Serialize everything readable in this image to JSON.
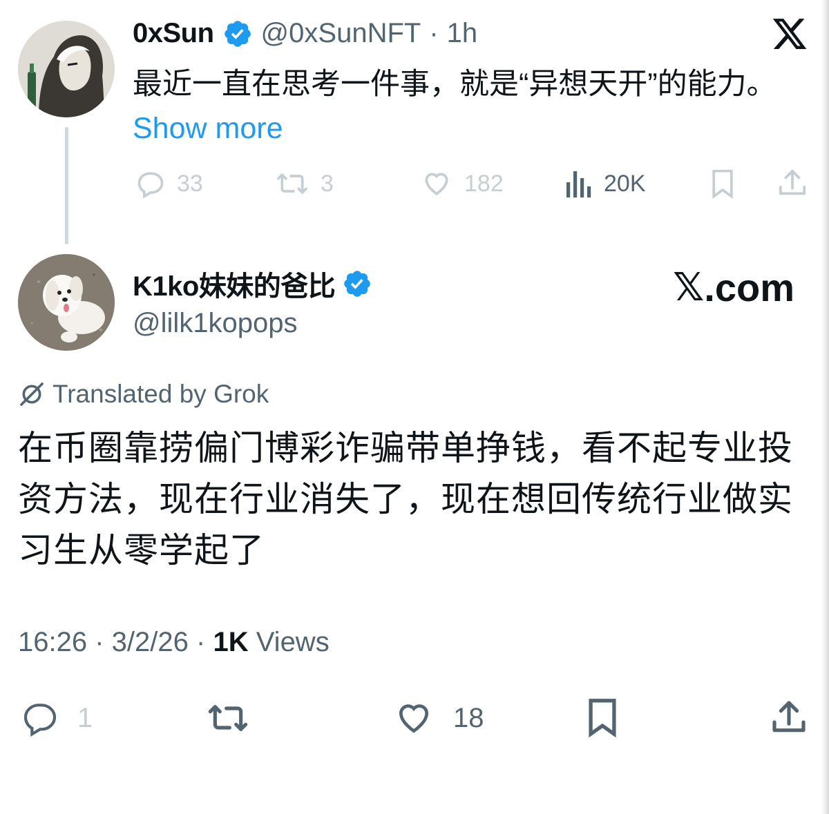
{
  "quoted_tweet": {
    "display_name": "0xSun",
    "handle": "@0xSunNFT",
    "separator": "·",
    "time": "1h",
    "text": "最近一直在思考一件事，就是“异想天开”的能力。",
    "show_more_label": "Show more",
    "actions": {
      "replies": "33",
      "retweets": "3",
      "likes": "182",
      "views": "20K"
    }
  },
  "reply_tweet": {
    "display_name": "K1ko妹妹的爸比",
    "handle": "@lilk1kopops",
    "translated_label": "Translated by Grok",
    "text": "在币圈靠捞偏门博彩诈骗带单挣钱，看不起专业投资方法，现在行业消失了，现在想回传统行业做实习生从零学起了",
    "time": "16:26",
    "date": "3/2/26",
    "views_count": "1K",
    "views_label": "Views",
    "actions": {
      "replies": "1",
      "likes": "18"
    }
  },
  "watermark": {
    "logo": "𝕏",
    "suffix": ".com"
  },
  "icons": {
    "brand": "x-logo-icon",
    "verified": "verified-badge-icon",
    "reply": "reply-icon",
    "retweet": "retweet-icon",
    "like": "heart-icon",
    "views": "analytics-icon",
    "bookmark": "bookmark-icon",
    "share": "share-icon",
    "grok": "grok-icon"
  },
  "colors": {
    "text": "#0f1419",
    "secondary": "#536471",
    "faint": "#c6ced3",
    "link": "#1d9bf0",
    "verified": "#1d9bf0",
    "thread_line": "#cfd9de"
  }
}
